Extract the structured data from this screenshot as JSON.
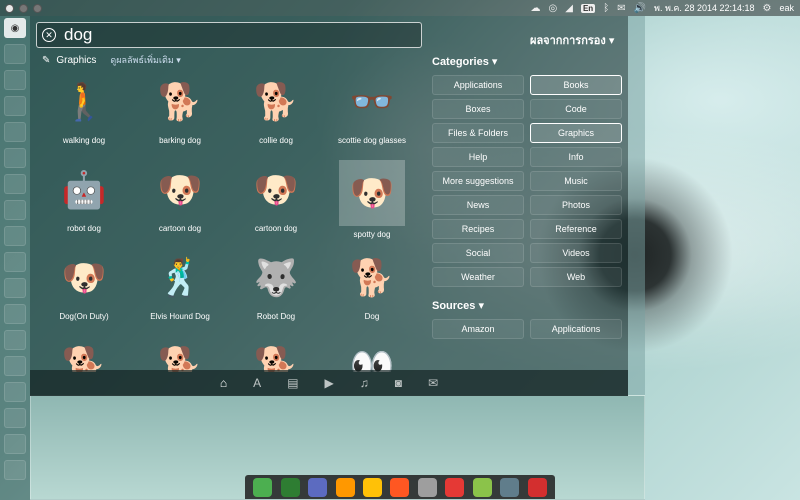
{
  "top_panel": {
    "keyboard_layout": "En",
    "datetime": "พ. พ.ค. 28 2014 22:14:18",
    "user": "eak"
  },
  "search": {
    "query": "dog"
  },
  "filter_toggle": "ผลจากการกรอง ▾",
  "group": {
    "name": "Graphics",
    "more_label": "ดูผลลัพธ์เพิ่มเติม ▾"
  },
  "results": [
    {
      "label": "walking dog",
      "icon": "walking-dog"
    },
    {
      "label": "barking dog",
      "icon": "barking-dog"
    },
    {
      "label": "collie dog",
      "icon": "collie-dog"
    },
    {
      "label": "scottie dog glasses",
      "icon": "glasses"
    },
    {
      "label": "robot dog",
      "icon": "robot-dog"
    },
    {
      "label": "cartoon dog",
      "icon": "cartoon-dog"
    },
    {
      "label": "cartoon dog",
      "icon": "cartoon-dog"
    },
    {
      "label": "spotty dog",
      "icon": "spotty-dog"
    },
    {
      "label": "Dog(On Duty)",
      "icon": "dog-on-duty"
    },
    {
      "label": "Elvis Hound Dog",
      "icon": "elvis-dog"
    },
    {
      "label": "Robot Dog",
      "icon": "robot-dog-2"
    },
    {
      "label": "Dog",
      "icon": "dog"
    },
    {
      "label": "",
      "icon": "black-dog"
    },
    {
      "label": "",
      "icon": "small-dog"
    },
    {
      "label": "",
      "icon": "brown-dog"
    },
    {
      "label": "",
      "icon": "eyes"
    }
  ],
  "filters": {
    "categories_title": "Categories ▾",
    "categories": [
      {
        "label": "Applications",
        "on": false
      },
      {
        "label": "Books",
        "on": true
      },
      {
        "label": "Boxes",
        "on": false
      },
      {
        "label": "Code",
        "on": false
      },
      {
        "label": "Files & Folders",
        "on": false
      },
      {
        "label": "Graphics",
        "on": true
      },
      {
        "label": "Help",
        "on": false
      },
      {
        "label": "Info",
        "on": false
      },
      {
        "label": "More suggestions",
        "on": false
      },
      {
        "label": "Music",
        "on": false
      },
      {
        "label": "News",
        "on": false
      },
      {
        "label": "Photos",
        "on": false
      },
      {
        "label": "Recipes",
        "on": false
      },
      {
        "label": "Reference",
        "on": false
      },
      {
        "label": "Social",
        "on": false
      },
      {
        "label": "Videos",
        "on": false
      },
      {
        "label": "Weather",
        "on": false
      },
      {
        "label": "Web",
        "on": false
      }
    ],
    "sources_title": "Sources ▾",
    "sources": [
      {
        "label": "Amazon",
        "on": false
      },
      {
        "label": "Applications",
        "on": false
      }
    ]
  },
  "lenses": [
    "home",
    "applications",
    "files",
    "video",
    "music",
    "photos",
    "social"
  ],
  "dock_colors": [
    "#4caf50",
    "#2e7d32",
    "#5c6bc0",
    "#ff9800",
    "#ffc107",
    "#ff5722",
    "#9e9e9e",
    "#e53935",
    "#8bc34a",
    "#607d8b",
    "#d32f2f"
  ]
}
